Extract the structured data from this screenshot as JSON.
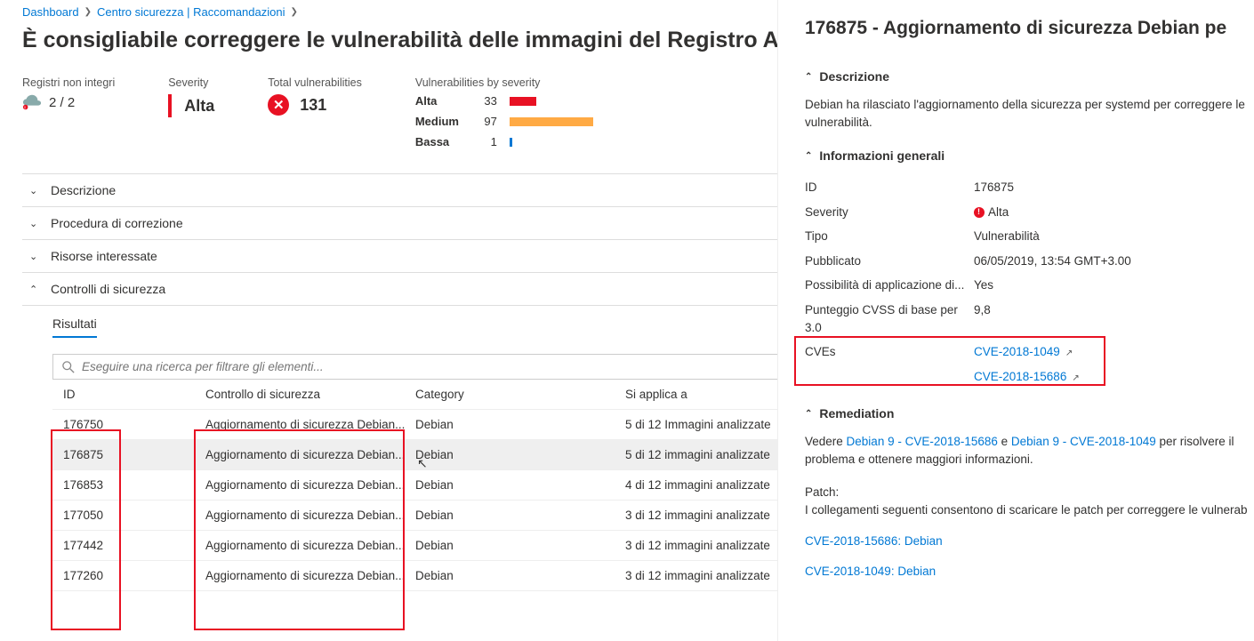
{
  "breadcrumb": {
    "dashboard": "Dashboard",
    "security_center": "Centro sicurezza | Raccomandazioni"
  },
  "title": "È consigliabile correggere le vulnerabilità delle immagini del Registro Azure C",
  "stats": {
    "registries_label": "Registri non integri",
    "registries_value": "2 / 2",
    "severity_label": "Severity",
    "severity_value": "Alta",
    "total_vuln_label": "Total vulnerabilities",
    "total_vuln_value": "131",
    "by_sev_label": "Vulnerabilities by severity",
    "high_label": "Alta",
    "high_value": "33",
    "medium_label": "Medium",
    "medium_value": "97",
    "low_label": "Bassa",
    "low_value": "1"
  },
  "accordion": {
    "description": "Descrizione",
    "remediation": "Procedura di correzione",
    "affected": "Risorse interessate",
    "controls": "Controlli di sicurezza"
  },
  "tab": {
    "results": "Risultati"
  },
  "search": {
    "placeholder": "Eseguire una ricerca per filtrare gli elementi..."
  },
  "table": {
    "headers": {
      "id": "ID",
      "control": "Controllo di sicurezza",
      "category": "Category",
      "applies": "Si applica a"
    },
    "rows": [
      {
        "id": "176750",
        "control": "Aggiornamento di sicurezza Debian...",
        "category": "Debian",
        "applies": "5 di 12 Immagini analizzate"
      },
      {
        "id": "176875",
        "control": "Aggiornamento di sicurezza Debian...",
        "category": "Debian",
        "applies": "5 di 12 immagini analizzate"
      },
      {
        "id": "176853",
        "control": "Aggiornamento di sicurezza Debian...",
        "category": "Debian",
        "applies": "4 di 12 immagini analizzate"
      },
      {
        "id": "177050",
        "control": "Aggiornamento di sicurezza Debian...",
        "category": "Debian",
        "applies": "3 di 12 immagini analizzate"
      },
      {
        "id": "177442",
        "control": "Aggiornamento di sicurezza Debian...",
        "category": "Debian",
        "applies": "3 di 12 immagini analizzate"
      },
      {
        "id": "177260",
        "control": "Aggiornamento di sicurezza Debian...",
        "category": "Debian",
        "applies": "3 di 12 immagini analizzate"
      }
    ]
  },
  "detail": {
    "title": "176875 - Aggiornamento di sicurezza Debian pe",
    "desc_head": "Descrizione",
    "desc_text": "Debian ha rilasciato l'aggiornamento della sicurezza per systemd per correggere le vulnerabilità.",
    "info_head": "Informazioni generali",
    "info": {
      "id_k": "ID",
      "id_v": "176875",
      "sev_k": "Severity",
      "sev_v": "Alta",
      "type_k": "Tipo",
      "type_v": "Vulnerabilità",
      "pub_k": "Pubblicato",
      "pub_v": "06/05/2019, 13:54 GMT+3.00",
      "app_k": "Possibilità di applicazione di...",
      "app_v": "Yes",
      "cvss_k": "Punteggio CVSS di base per 3.0",
      "cvss_v": "9,8",
      "cves_k": "CVEs",
      "cve1": "CVE-2018-1049",
      "cve2": "CVE-2018-15686"
    },
    "rem_head": "Remediation",
    "rem_text1": "Vedere ",
    "rem_link1": "Debian 9 - CVE-2018-15686",
    "rem_and": " e ",
    "rem_link2": "Debian 9 - CVE-2018-1049",
    "rem_text2": " per risolvere il problema e ottenere maggiori informazioni.",
    "patch_label": "Patch:",
    "patch_text": "I collegamenti seguenti consentono di scaricare le patch per correggere le vulnerab",
    "patch_link1": "CVE-2018-15686: Debian",
    "patch_link2": "CVE-2018-1049: Debian"
  }
}
